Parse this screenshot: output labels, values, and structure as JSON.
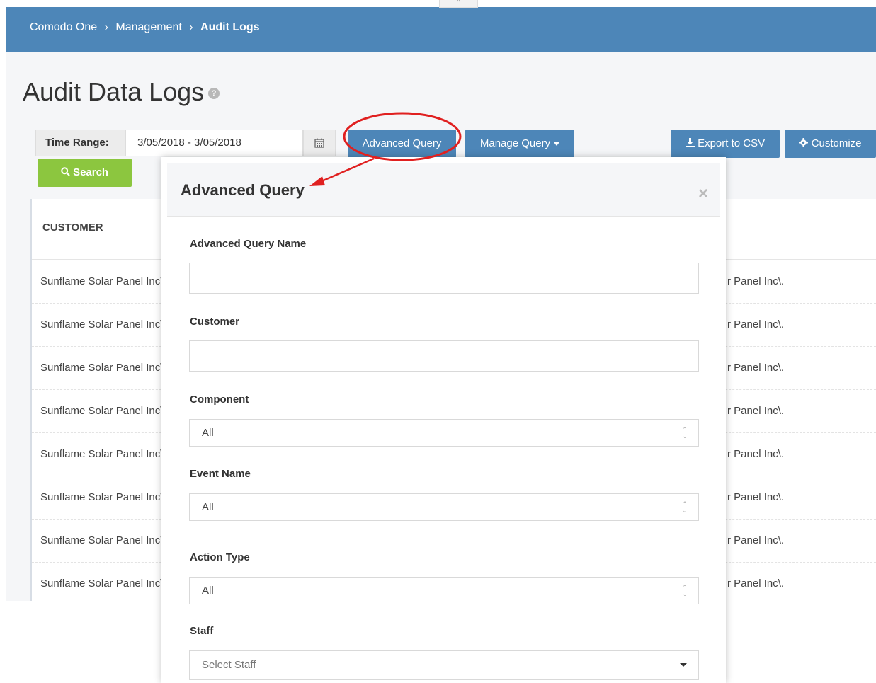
{
  "breadcrumb": {
    "item1": "Comodo One",
    "sep1": "›",
    "item2": "Management",
    "sep2": "›",
    "current": "Audit Logs"
  },
  "collapse_glyph": "^",
  "page": {
    "title": "Audit Data Logs",
    "help_icon": "?"
  },
  "toolbar": {
    "time_range_label": "Time Range:",
    "time_range_value": "3/05/2018 - 3/05/2018",
    "calendar_icon": "calendar-icon",
    "advanced_query_label": "Advanced Query",
    "manage_query_label": "Manage Query",
    "export_label": "Export to CSV",
    "customize_label": "Customize",
    "search_label": "Search"
  },
  "table": {
    "column_customer": "CUSTOMER",
    "rows_left": [
      "Sunflame Solar Panel Inc\\.",
      "Sunflame Solar Panel Inc\\.",
      "Sunflame Solar Panel Inc\\.",
      "Sunflame Solar Panel Inc\\.",
      "Sunflame Solar Panel Inc\\.",
      "Sunflame Solar Panel Inc\\.",
      "Sunflame Solar Panel Inc\\.",
      "Sunflame Solar Panel Inc\\."
    ],
    "rows_right": [
      "r Panel Inc\\.",
      "r Panel Inc\\.",
      "r Panel Inc\\.",
      "r Panel Inc\\.",
      "r Panel Inc\\.",
      "r Panel Inc\\.",
      "r Panel Inc\\.",
      "r Panel Inc\\."
    ]
  },
  "modal": {
    "title": "Advanced Query",
    "close_glyph": "×",
    "fields": {
      "query_name_label": "Advanced Query Name",
      "query_name_value": "",
      "customer_label": "Customer",
      "customer_value": "",
      "component_label": "Component",
      "component_value": "All",
      "event_name_label": "Event Name",
      "event_name_value": "All",
      "action_type_label": "Action Type",
      "action_type_value": "All",
      "staff_label": "Staff",
      "staff_placeholder": "Select Staff"
    }
  },
  "colors": {
    "header_blue": "#4d86b8",
    "search_green": "#8cc63f",
    "annotation_red": "#e02020"
  }
}
